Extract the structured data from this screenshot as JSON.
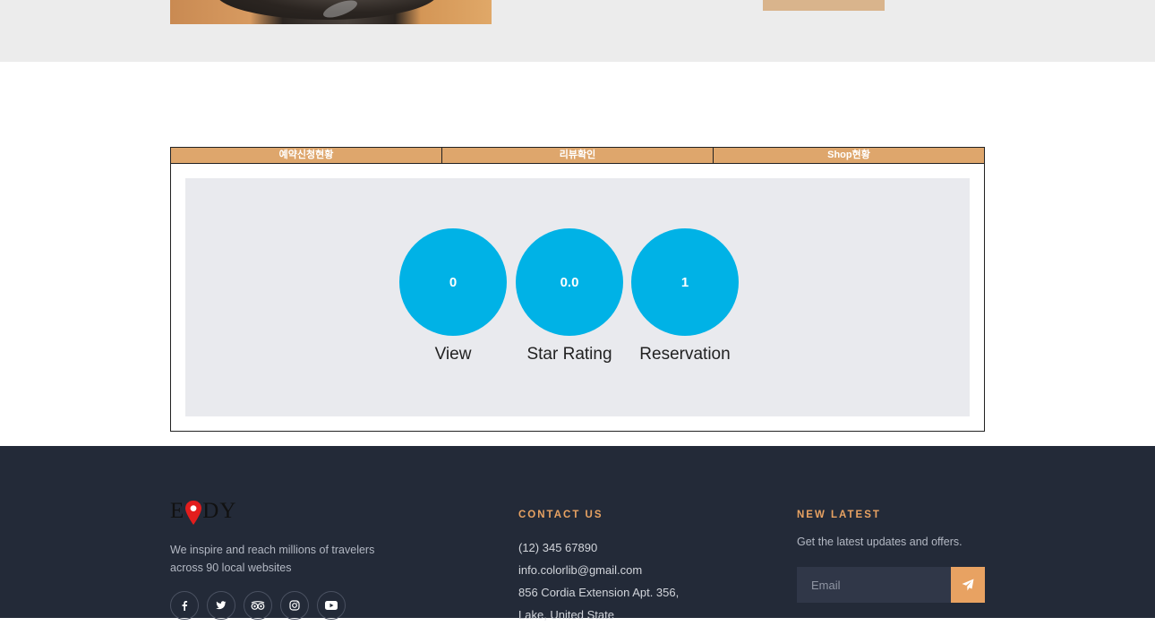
{
  "tabs": [
    {
      "label": "예약신청현황"
    },
    {
      "label": "리뷰확인"
    },
    {
      "label": "Shop현황"
    }
  ],
  "stats": [
    {
      "value": "0",
      "label": "View"
    },
    {
      "value": "0.0",
      "label": "Star Rating"
    },
    {
      "value": "1",
      "label": "Reservation"
    }
  ],
  "footer": {
    "logo_text_left": "E",
    "logo_text_right": "DY",
    "about_line1": "We inspire and reach millions of travelers",
    "about_line2": "across 90 local websites",
    "socials": [
      "facebook-icon",
      "twitter-icon",
      "tripadvisor-icon",
      "instagram-icon",
      "youtube-icon"
    ],
    "contact": {
      "title": "CONTACT US",
      "phone": "(12) 345 67890",
      "email": "info.colorlib@gmail.com",
      "address_line1": "856 Cordia Extension Apt. 356,",
      "address_line2": "Lake, United State"
    },
    "newsletter": {
      "title": "NEW LATEST",
      "text": "Get the latest updates and offers.",
      "email_placeholder": "Email"
    }
  },
  "colors": {
    "accent": "#e8a262",
    "tab_bg": "#dea66c",
    "stat_circle": "#00b2e6",
    "footer_bg": "#232a38"
  }
}
